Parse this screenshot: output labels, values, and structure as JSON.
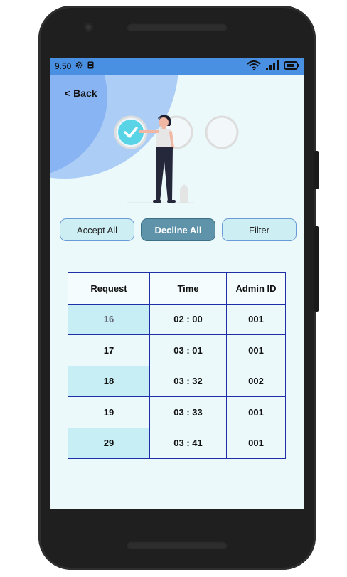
{
  "status_bar": {
    "time": "9.50"
  },
  "nav": {
    "back_label": "< Back"
  },
  "actions": {
    "accept_all": "Accept All",
    "decline_all": "Decline All",
    "filter": "Filter"
  },
  "table": {
    "headers": [
      "Request",
      "Time",
      "Admin ID"
    ],
    "rows": [
      [
        "16",
        "02 : 00",
        "001"
      ],
      [
        "17",
        "03 : 01",
        "001"
      ],
      [
        "18",
        "03 : 32",
        "002"
      ],
      [
        "19",
        "03 : 33",
        "001"
      ],
      [
        "29",
        "03 : 41",
        "001"
      ]
    ]
  },
  "colors": {
    "status_bar": "#4a90e2",
    "screen_bg": "#ecf9fb",
    "decline_button": "#5f93aa",
    "table_border": "#1f2fa8",
    "shaded_cell": "#c7eef4"
  },
  "icons": [
    "gear-icon",
    "battery-saver-icon",
    "wifi-icon",
    "signal-icon",
    "battery-icon",
    "checkmark-icon"
  ]
}
